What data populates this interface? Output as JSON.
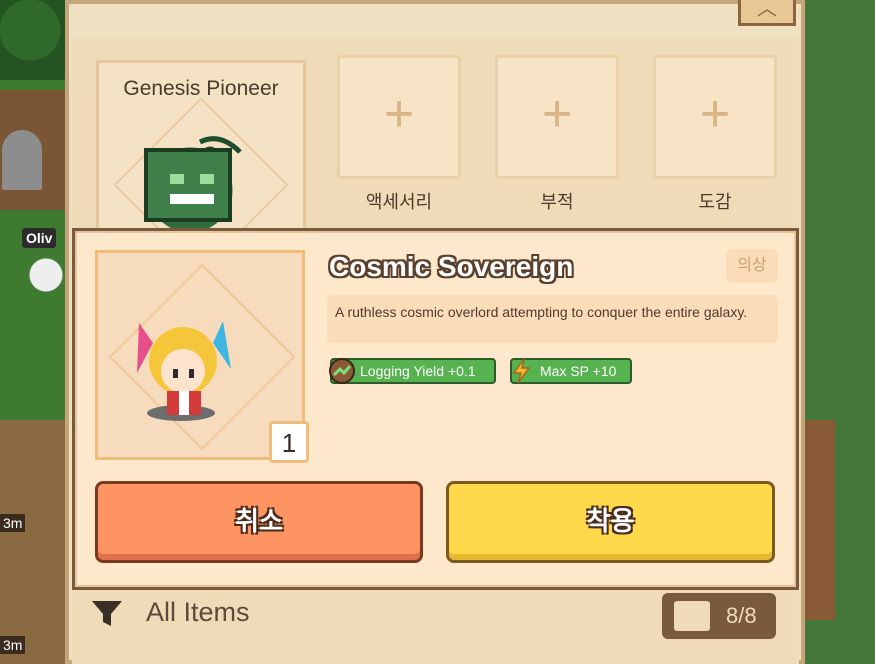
{
  "background": {
    "npc_name_tag": "Oliv",
    "timers": [
      "3m",
      "3m"
    ]
  },
  "inventory": {
    "character_title": "Genesis Pioneer",
    "slots": [
      {
        "label": "액세서리"
      },
      {
        "label": "부적"
      },
      {
        "label": "도감"
      }
    ],
    "filter_label": "All Items",
    "item_count": "8/8"
  },
  "modal": {
    "item_name": "Cosmic Sovereign",
    "category": "의상",
    "description": "A ruthless cosmic overlord attempting to conquer the entire galaxy.",
    "quantity": "1",
    "stats": [
      {
        "label": "Logging Yield +0.1",
        "icon": "growth-arrow-icon"
      },
      {
        "label": "Max SP +10",
        "icon": "lightning-icon"
      }
    ],
    "cancel_label": "취소",
    "apply_label": "착용"
  },
  "colors": {
    "cancel_button": "#ff9463",
    "apply_button": "#ffd84c",
    "stat_badge": "#57b250"
  }
}
